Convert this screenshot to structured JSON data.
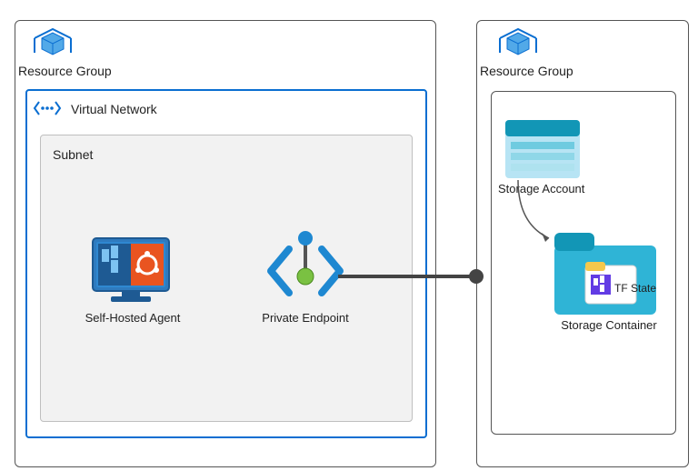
{
  "left_group": {
    "label": "Resource Group",
    "vnet_label": "Virtual Network",
    "subnet_label": "Subnet",
    "agent_label": "Self-Hosted Agent",
    "pe_label": "Private Endpoint"
  },
  "right_group": {
    "label": "Resource Group",
    "storage_account_label": "Storage Account",
    "storage_container_label": "Storage Container",
    "tf_state_label": "TF State"
  }
}
